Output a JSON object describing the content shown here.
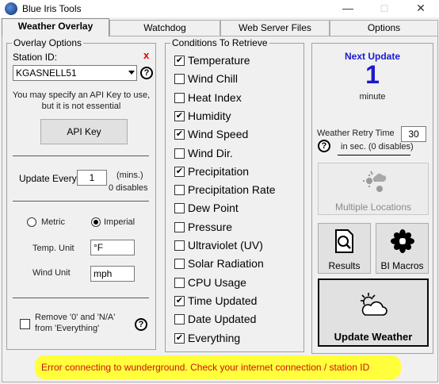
{
  "window": {
    "title": "Blue Iris Tools"
  },
  "tabs": [
    {
      "label": "Weather Overlay",
      "active": true
    },
    {
      "label": "Watchdog"
    },
    {
      "label": "Web Server Files"
    },
    {
      "label": "Options"
    }
  ],
  "overlay_options": {
    "legend": "Overlay Options",
    "station_label": "Station ID:",
    "station_clear": "x",
    "station_value": "KGASNELL51",
    "help": "?",
    "api_note_line1": "You may specify an API Key to use,",
    "api_note_line2": "but it is not essential",
    "api_key_button": "API Key",
    "update_every_label": "Update Every",
    "update_every_value": "1",
    "update_unit": "(mins.)",
    "update_disable": "0 disables",
    "metric_label": "Metric",
    "imperial_label": "Imperial",
    "unit_selected": "Imperial",
    "temp_unit_label": "Temp. Unit",
    "temp_unit_value": "°F",
    "wind_unit_label": "Wind Unit",
    "wind_unit_value": "mph",
    "remove_line1": "Remove '0' and  'N/A'",
    "remove_line2": "from 'Everything'",
    "remove_checked": false
  },
  "conditions": {
    "legend": "Conditions To Retrieve",
    "items": [
      {
        "label": "Temperature",
        "checked": true
      },
      {
        "label": "Wind Chill",
        "checked": false
      },
      {
        "label": "Heat Index",
        "checked": false
      },
      {
        "label": "Humidity",
        "checked": true
      },
      {
        "label": "Wind Speed",
        "checked": true
      },
      {
        "label": "Wind Dir.",
        "checked": false
      },
      {
        "label": "Precipitation",
        "checked": true
      },
      {
        "label": "Precipitation Rate",
        "checked": false
      },
      {
        "label": "Dew Point",
        "checked": false
      },
      {
        "label": "Pressure",
        "checked": false
      },
      {
        "label": "Ultraviolet (UV)",
        "checked": false
      },
      {
        "label": "Solar Radiation",
        "checked": false
      },
      {
        "label": "CPU Usage",
        "checked": false
      },
      {
        "label": "Time Updated",
        "checked": true
      },
      {
        "label": "Date Updated",
        "checked": false
      },
      {
        "label": "Everything",
        "checked": true
      }
    ]
  },
  "right_panel": {
    "next_update_title": "Next Update",
    "next_update_value": "1",
    "next_update_unit": "minute",
    "retry_label": "Weather Retry Time",
    "retry_value": "30",
    "retry_note": "in sec. (0 disables)",
    "help": "?",
    "multiple_locations": "Multiple Locations",
    "results": "Results",
    "bi_macros": "BI Macros",
    "update_weather": "Update Weather"
  },
  "status": {
    "message": "Error connecting to wunderground. Check your internet connection / station ID"
  },
  "colors": {
    "accent": "#1a1acd",
    "error": "#d01010",
    "status_bg": "#ffff3c"
  }
}
